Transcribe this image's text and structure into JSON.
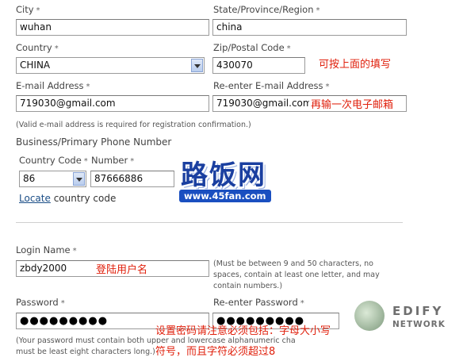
{
  "address": {
    "city_label": "City",
    "city_value": "wuhan",
    "state_label": "State/Province/Region",
    "state_value": "china",
    "country_label": "Country",
    "country_value": "CHINA",
    "zip_label": "Zip/Postal Code",
    "zip_value": "430070",
    "zip_note": "可按上面的填写",
    "required_mark": "*"
  },
  "email": {
    "email_label": "E-mail Address",
    "email_value": "719030@gmail.com",
    "reenter_label": "Re-enter E-mail Address",
    "reenter_value": "719030@gmail.com",
    "reenter_note": "再输一次电子邮箱",
    "validity_note": "(Valid e-mail address is required for registration confirmation.)"
  },
  "phone": {
    "section_label": "Business/Primary Phone Number",
    "country_code_label": "Country Code",
    "country_code_value": "86",
    "number_label": "Number",
    "number_value": "87666886",
    "locate_link": "Locate",
    "locate_suffix": "country code"
  },
  "watermark": {
    "logo_text": "路饭网",
    "logo_url": "www.45fan.com",
    "edify_top": "EDIFY",
    "edify_bottom": "NETWORK"
  },
  "login": {
    "login_label": "Login Name",
    "login_value": "zbdy2000",
    "login_note_cn": "登陆用户名",
    "login_rules": "(Must be between 9 and 50 characters, no spaces, contain at least one letter, and may contain numbers.)",
    "password_label": "Password",
    "password_value": "●●●●●●●●●",
    "reenter_password_label": "Re-enter Password",
    "reenter_password_value": "●●●●●●●●●",
    "password_note_cn_1": "设置密码请注意必须包括：字母大小写",
    "password_note_cn_2": "符号，而且字符必须超过8",
    "password_rules_1": "(Your password must contain both upper and lowercase alphanumeric cha",
    "password_rules_2": "must be least eight characters long.)"
  }
}
